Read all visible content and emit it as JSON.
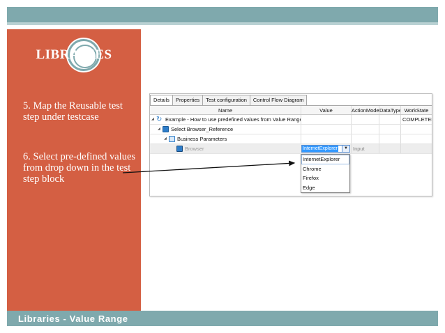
{
  "slide": {
    "title": "LIBRARIES",
    "steps": [
      "5. Map the Reusable test step under testcase",
      "6. Select pre-defined values from drop down in the test step block"
    ],
    "footer": "Libraries - Value Range"
  },
  "app": {
    "tabs": [
      "Details",
      "Properties",
      "Test configuration",
      "Control Flow Diagram"
    ],
    "columns": {
      "name": "Name",
      "value": "Value",
      "action_mode": "ActionMode",
      "data_type": "DataType",
      "work_state": "WorkState"
    },
    "rows": [
      {
        "name": "Example - How to use predefined values from Value Range",
        "work_state": "COMPLETED"
      },
      {
        "name": "Select Browser_Reference"
      },
      {
        "name": "Business Parameters"
      },
      {
        "name": "Browser",
        "value": "InternetExplorer",
        "action_mode": "Input"
      }
    ],
    "dropdown": {
      "options": [
        "InternetExplorer",
        "Chrome",
        "Firefox",
        "Edge"
      ],
      "highlighted": "InternetExplorer"
    }
  },
  "colors": {
    "teal": "#7fa9ad",
    "panel": "#d45f43",
    "selection": "#3399ff"
  }
}
